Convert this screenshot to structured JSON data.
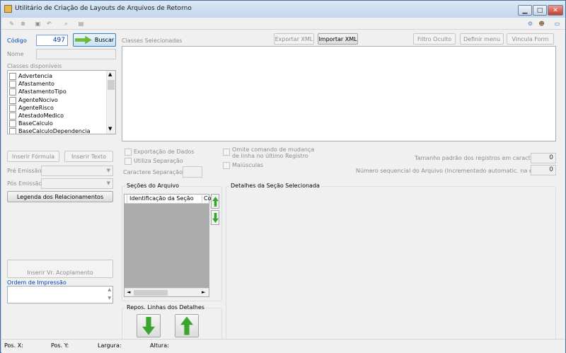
{
  "window": {
    "title": "Utilitário de Criação de Layouts de Arquivos de Retorno",
    "min_label": "▁",
    "max_label": "□",
    "close_label": "✕"
  },
  "codigo": {
    "label": "Código",
    "value": "497",
    "buscar_label": "Buscar"
  },
  "nome": {
    "label": "Nome",
    "value": ""
  },
  "classes_disponiveis": {
    "label": "Classes disponíveis",
    "items": [
      "Advertencia",
      "Afastamento",
      "AfastamentoTipo",
      "AgenteNocivo",
      "AgenteRisco",
      "AtestadoMedico",
      "BaseCalculo",
      "BaseCalculoDependencia"
    ]
  },
  "classes_selecionadas": {
    "label": "Classes Selecionadas"
  },
  "toolbar_buttons": {
    "exportar_xml": "Exportar XML",
    "importar_xml": "Importar XML",
    "filtro_oculto": "Filtro Oculto",
    "definir_menu": "Definir menu",
    "vincula_form": "Vincula Form"
  },
  "left_buttons": {
    "inserir_formula": "Inserir Fórmula",
    "inserir_texto": "Inserir Texto",
    "legenda": "Legenda dos Relacionamentos",
    "inserir_acoplamento": "Inserir Vr. Acoplamento"
  },
  "emissao": {
    "pre_label": "Pré Emissão",
    "pos_label": "Pós Emissão"
  },
  "options": {
    "exportacao_dados": "Exportação de Dados",
    "utiliza_separacao": "Utiliza Separação",
    "caractere_separacao": "Caractere Separação:",
    "omite_comando": "Omite comando de mudança",
    "omite_comando_2": "de linha no último Registro",
    "maiusculas": "Maiúsculas"
  },
  "tamanho": {
    "label": "Tamanho padrão dos registros em caracteres:",
    "value": "0"
  },
  "sequencial": {
    "label": "Número sequencial do Arquivo (Incrementado automatic. na emissão):",
    "value": "0"
  },
  "secoes": {
    "title": "Seções do Arquivo",
    "col1": "Identificação da Seção",
    "col2": "Co"
  },
  "detalhes": {
    "title": "Detalhes da Seção Selecionada"
  },
  "ordem": {
    "label": "Ordem de Impressão"
  },
  "repos": {
    "title": "Repos. Linhas dos Detalhes"
  },
  "status": {
    "posx": "Pos. X:",
    "posy": "Pos. Y:",
    "largura": "Largura:",
    "altura": "Altura:"
  }
}
